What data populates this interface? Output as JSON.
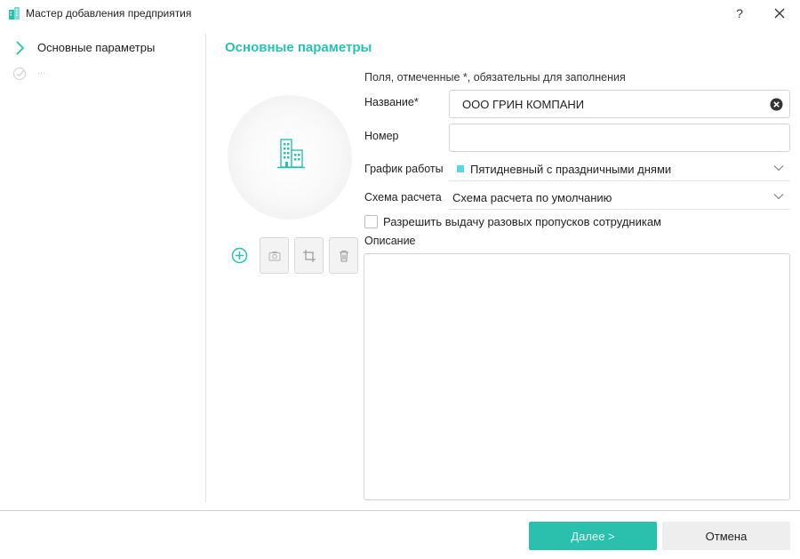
{
  "window": {
    "title": "Мастер добавления предприятия",
    "help_label": "?",
    "icons": {
      "app": "building-icon",
      "help": "question-mark",
      "close": "close-icon"
    }
  },
  "sidebar": {
    "steps": [
      {
        "label": "Основные параметры",
        "icon": "chevron-right-icon",
        "state": "active"
      },
      {
        "label": "...",
        "icon": "check-circle-icon",
        "state": "pending"
      }
    ]
  },
  "form": {
    "section_title": "Основные параметры",
    "required_note": "Поля, отмеченные *, обязательны для заполнения",
    "photo_tools": {
      "icons": [
        "add-circle-icon",
        "camera-icon",
        "crop-icon",
        "trash-icon"
      ]
    },
    "name": {
      "label": "Название*",
      "value": "ООО ГРИН КОМПАНИ"
    },
    "number": {
      "label": "Номер",
      "value": ""
    },
    "schedule": {
      "label": "График работы",
      "value": "Пятидневный с праздничными днями",
      "swatch_color": "#5bd6e3"
    },
    "scheme": {
      "label": "Схема расчета",
      "value": "Схема расчета по умолчанию"
    },
    "one_time_passes": {
      "label": "Разрешить выдачу разовых пропусков сотрудникам",
      "checked": false
    },
    "description": {
      "label": "Описание",
      "value": ""
    }
  },
  "footer": {
    "next_label": "Далее >",
    "cancel_label": "Отмена"
  },
  "colors": {
    "accent": "#2bbfae",
    "next_text": "#e9fffb",
    "cancel_bg": "#eeeeee"
  }
}
